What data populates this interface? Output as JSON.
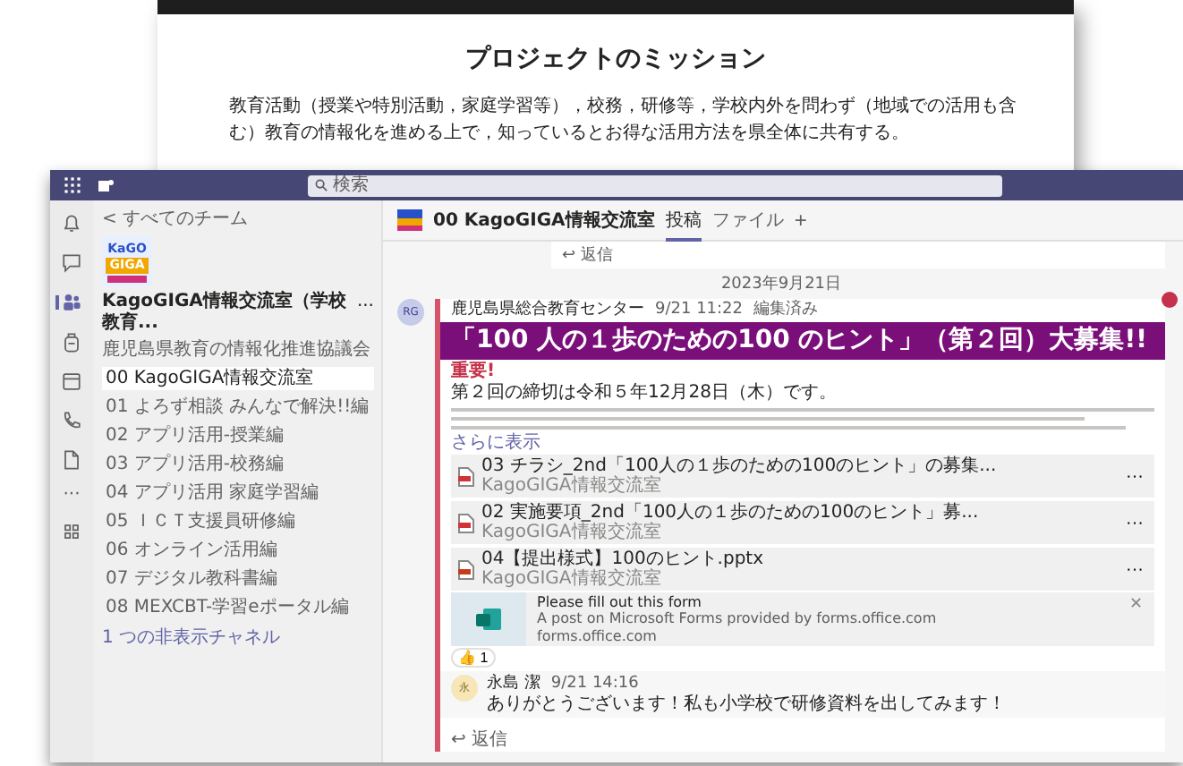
{
  "background_page": {
    "heading": "プロジェクトのミッション",
    "paragraph": "教育活動（授業や特別活動，家庭学習等），校務，研修等，学校内外を問わず（地域での活用も含む）教育の情報化を進める上で，知っているとお得な活用方法を県全体に共有する。"
  },
  "teams": {
    "search": {
      "placeholder": "検索"
    },
    "rail": [
      {
        "kind": "bell",
        "selected": false
      },
      {
        "kind": "chat",
        "selected": false
      },
      {
        "kind": "teams",
        "selected": true
      },
      {
        "kind": "backpack",
        "selected": false
      },
      {
        "kind": "calendar",
        "selected": false
      },
      {
        "kind": "phone",
        "selected": false
      },
      {
        "kind": "file",
        "selected": false
      },
      {
        "kind": "more",
        "label": "···",
        "selected": false
      },
      {
        "kind": "apps",
        "selected": false
      }
    ],
    "team_pane": {
      "back": "< すべてのチーム",
      "logo": [
        "KaGO",
        "GIGA"
      ],
      "team_name": "KagoGIGA情報交流室（学校教育...",
      "more": "...",
      "home": "鹿児島県教育の情報化推進協議会",
      "channels": [
        {
          "name": "00 KagoGIGA情報交流室",
          "selected": true
        },
        {
          "name": "01 よろず相談 みんなで解決!!編",
          "selected": false
        },
        {
          "name": "02 アプリ活用-授業編",
          "selected": false
        },
        {
          "name": "03 アプリ活用-校務編",
          "selected": false
        },
        {
          "name": "04 アプリ活用 家庭学習編",
          "selected": false
        },
        {
          "name": "05 ＩＣＴ支援員研修編",
          "selected": false
        },
        {
          "name": "06 オンライン活用編",
          "selected": false
        },
        {
          "name": "07 デジタル教科書編",
          "selected": false
        },
        {
          "name": "08 MEXCBT-学習eポータル編",
          "selected": false
        }
      ],
      "hidden_channels": "1 つの非表示チャネル"
    },
    "channel_header": {
      "title": "00 KagoGIGA情報交流室",
      "tabs": [
        {
          "label": "投稿",
          "selected": true
        },
        {
          "label": "ファイル",
          "selected": false
        }
      ],
      "add": "+"
    },
    "top_reply": "↩ 返信",
    "date": "2023年9月21日",
    "post": {
      "avatar": "RG",
      "author": "鹿児島県総合教育センター",
      "time": "9/21 11:22",
      "edited": "編集済み",
      "banner": "「100 人の１歩のための100 のヒント」（第２回）大募集!!",
      "importance": "重要!",
      "headline": "第２回の締切は令和５年12月28日（木）です。",
      "see_more": "さらに表示",
      "attachments": [
        {
          "kind": "pdf",
          "name": "03 チラシ_2nd「100人の１歩のための100のヒント」の募集...",
          "location": "KagoGIGA情報交流室",
          "more": "···"
        },
        {
          "kind": "pdf",
          "name": "02 実施要項_2nd「100人の１歩のための100のヒント」募...",
          "location": "KagoGIGA情報交流室",
          "more": "···"
        },
        {
          "kind": "pptx",
          "name": "04【提出様式】100のヒント.pptx",
          "location": "KagoGIGA情報交流室",
          "more": "···"
        }
      ],
      "link_preview": {
        "title": "Please fill out this form",
        "description": "A post on Microsoft Forms provided by forms.office.com",
        "domain": "forms.office.com",
        "close": "✕"
      },
      "reaction": {
        "emoji": "👍",
        "count": "1"
      },
      "replies": [
        {
          "avatar": "永",
          "author": "永島 潔",
          "time": "9/21 14:16",
          "text": "ありがとうございます！私も小学校で研修資料を出してみます！"
        }
      ],
      "reply_button": "↩ 返信"
    }
  }
}
